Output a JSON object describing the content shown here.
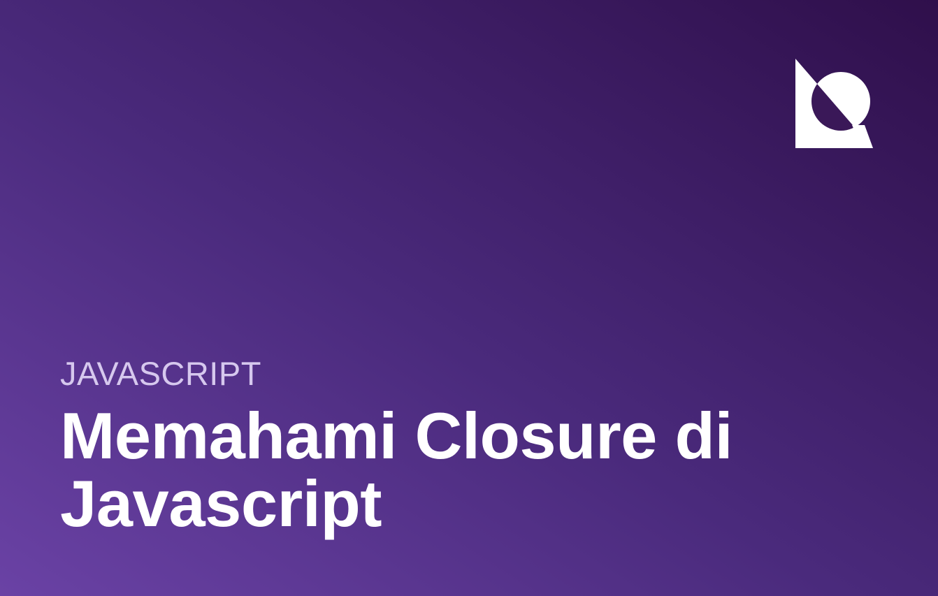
{
  "colors": {
    "background_start": "#6a42a5",
    "background_end": "#2f0f4b",
    "category_text": "#d6c8ee",
    "title_text": "#ffffff",
    "logo": "#ffffff"
  },
  "logo": {
    "icon": "brand-logo-icon"
  },
  "category": "JAVASCRIPT",
  "title": "Memahami Closure di Javascript"
}
